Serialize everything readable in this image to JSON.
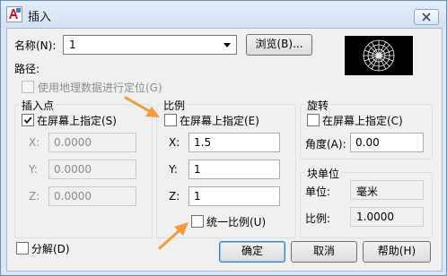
{
  "window": {
    "title": "插入",
    "close_icon": "close-icon"
  },
  "name_row": {
    "label": "名称(N):",
    "value": "1",
    "browse_label": "浏览(B)..."
  },
  "path": {
    "label": "路径:"
  },
  "geo": {
    "label": "使用地理数据进行定位(G)",
    "checked": false
  },
  "insertion": {
    "title": "插入点",
    "onscreen_label": "在屏幕上指定(S)",
    "onscreen_checked": true,
    "x_label": "X:",
    "x_value": "0.0000",
    "y_label": "Y:",
    "y_value": "0.0000",
    "z_label": "Z:",
    "z_value": "0.0000"
  },
  "scale": {
    "title": "比例",
    "onscreen_label": "在屏幕上指定(E)",
    "onscreen_checked": false,
    "x_label": "X:",
    "x_value": "1.5",
    "y_label": "Y:",
    "y_value": "1",
    "z_label": "Z:",
    "z_value": "1",
    "uniform_label": "统一比例(U)",
    "uniform_checked": false
  },
  "rotation": {
    "title": "旋转",
    "onscreen_label": "在屏幕上指定(C)",
    "onscreen_checked": false,
    "angle_label": "角度(A):",
    "angle_value": "0.00"
  },
  "block_unit": {
    "title": "块单位",
    "unit_label": "单位:",
    "unit_value": "毫米",
    "factor_label": "比例:",
    "factor_value": "1.0000"
  },
  "explode": {
    "label": "分解(D)",
    "checked": false
  },
  "buttons": {
    "ok": "确定",
    "cancel": "取消",
    "help": "帮助(H)"
  },
  "colors": {
    "annotation_arrow": "#f39a3a",
    "preview_bg": "#000000"
  }
}
